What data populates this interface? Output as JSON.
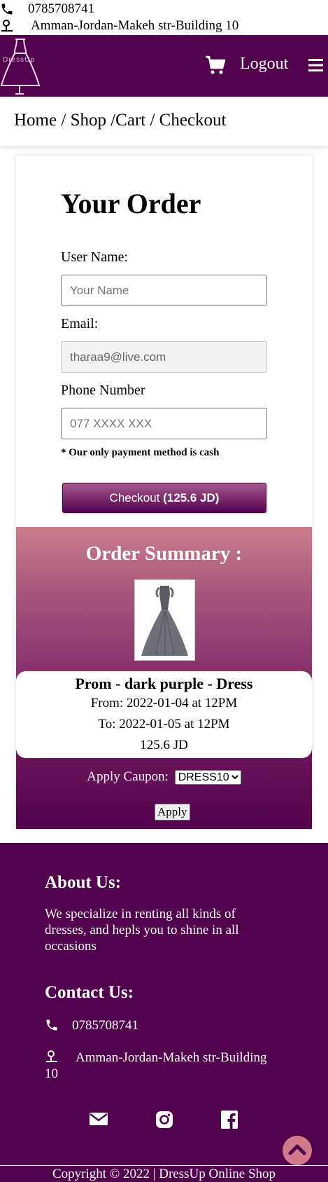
{
  "topbar": {
    "phone": "0785708741",
    "address": "Amman-Jordan-Makeh str-Building 10"
  },
  "nav": {
    "logo_text": "DressUp",
    "logout": "Logout"
  },
  "breadcrumb": {
    "home": "Home",
    "shop": "Shop",
    "cart": "Cart",
    "checkout": "Checkout"
  },
  "order": {
    "title": "Your Order",
    "username_label": "User Name:",
    "username_placeholder": "Your Name",
    "email_label": "Email:",
    "email_value": "tharaa9@live.com",
    "phone_label": "Phone Number",
    "phone_placeholder": "077 XXXX XXX",
    "note": "* Our only payment method is cash",
    "checkout_label": "Checkout",
    "checkout_total": "(125.6 JD)"
  },
  "summary": {
    "title": "Order Summary :",
    "product_name": "Prom - dark purple - Dress",
    "from": "From: 2022-01-04 at 12PM",
    "to": "To: 2022-01-05 at 12PM",
    "price": "125.6 JD",
    "coupon_label": "Apply Caupon:",
    "coupon_selected": "DRESS10",
    "apply_label": "Apply"
  },
  "footer": {
    "about_title": "About Us:",
    "about_text": "We specialize in renting all kinds of dresses, and hepls you to shine in all occasions",
    "contact_title": "Contact Us:",
    "phone": "0785708741",
    "address": "Amman-Jordan-Makeh str-Building 10",
    "copyright": "Copyright © 2022 | DressUp Online Shop"
  },
  "colors": {
    "brand": "#52024d",
    "summary_top": "#c97c89",
    "scroll_button": "#d07a8c"
  },
  "icons": [
    "phone-icon",
    "location-pin-icon",
    "dress-logo-icon",
    "cart-icon",
    "hamburger-menu-icon",
    "dress-image",
    "mail-icon",
    "instagram-icon",
    "facebook-icon",
    "chevron-up-icon"
  ]
}
